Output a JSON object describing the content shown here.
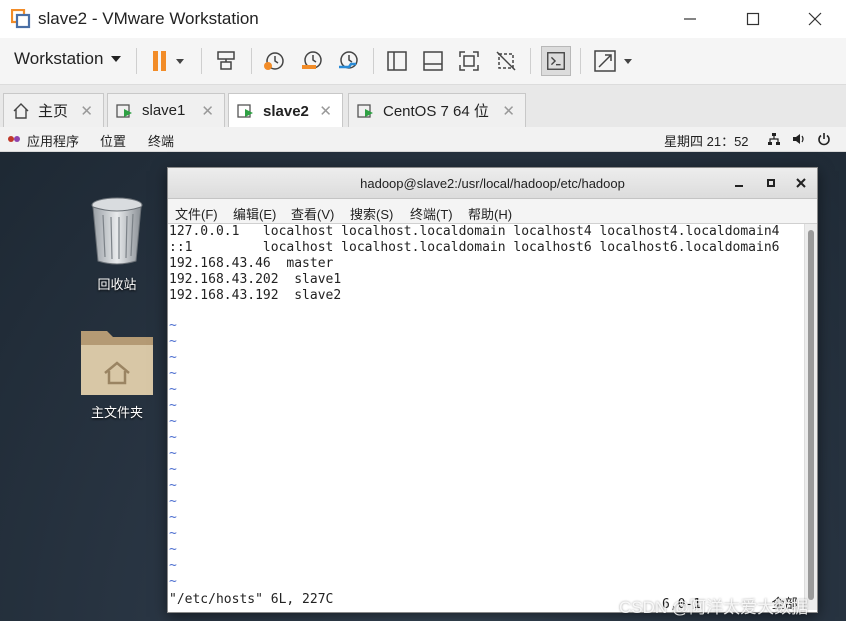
{
  "window": {
    "title": "slave2 - VMware Workstation",
    "accent": "#f28c28"
  },
  "toolbar": {
    "workstation_label": "Workstation"
  },
  "tabs": [
    {
      "label": "主页",
      "icon": "home-icon"
    },
    {
      "label": "slave1",
      "icon": "vm-icon"
    },
    {
      "label": "slave2",
      "icon": "vm-icon",
      "active": true
    },
    {
      "label": "CentOS 7 64 位",
      "icon": "vm-icon"
    }
  ],
  "gnome_bar": {
    "apps": "应用程序",
    "places": "位置",
    "terminal": "终端",
    "clock": "星期四 21：52"
  },
  "desktop": {
    "trash_label": "回收站",
    "home_label": "主文件夹"
  },
  "terminal": {
    "title": "hadoop@slave2:/usr/local/hadoop/etc/hadoop",
    "menu": [
      "文件(F)",
      "编辑(E)",
      "查看(V)",
      "搜索(S)",
      "终端(T)",
      "帮助(H)"
    ],
    "lines": [
      "127.0.0.1   localhost localhost.localdomain localhost4 localhost4.localdomain4",
      "::1         localhost localhost.localdomain localhost6 localhost6.localdomain6",
      "192.168.43.46  master",
      "192.168.43.202  slave1",
      "192.168.43.192  slave2"
    ],
    "tilde": "~",
    "tilde_count": 17,
    "status_left": "\"/etc/hosts\" 6L, 227C",
    "status_right": "6,0-1         全部"
  },
  "watermark": "CSDN @阿洋太爱大数据"
}
